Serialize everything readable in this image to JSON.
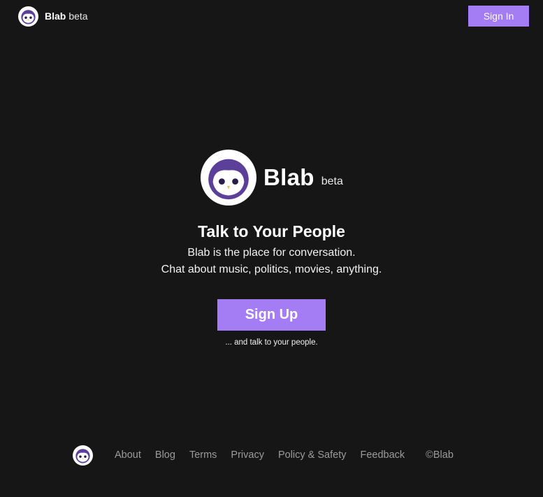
{
  "header": {
    "brand_name": "Blab",
    "brand_tag": "beta",
    "signin_label": "Sign In"
  },
  "hero": {
    "brand_name": "Blab",
    "brand_tag": "beta",
    "title": "Talk to Your People",
    "line1": "Blab is the place for conversation.",
    "line2": "Chat about music, politics, movies, anything.",
    "signup_label": "Sign Up",
    "signup_caption": "... and talk to your people."
  },
  "footer": {
    "links": [
      "About",
      "Blog",
      "Terms",
      "Privacy",
      "Policy & Safety",
      "Feedback"
    ],
    "copyright": "©Blab"
  },
  "icons": {
    "logo": "owl-logo-icon"
  },
  "colors": {
    "background": "#161616",
    "accent": "#a47cf3",
    "owl_purple": "#5b3f99",
    "footer_link": "#9b9b9b"
  }
}
